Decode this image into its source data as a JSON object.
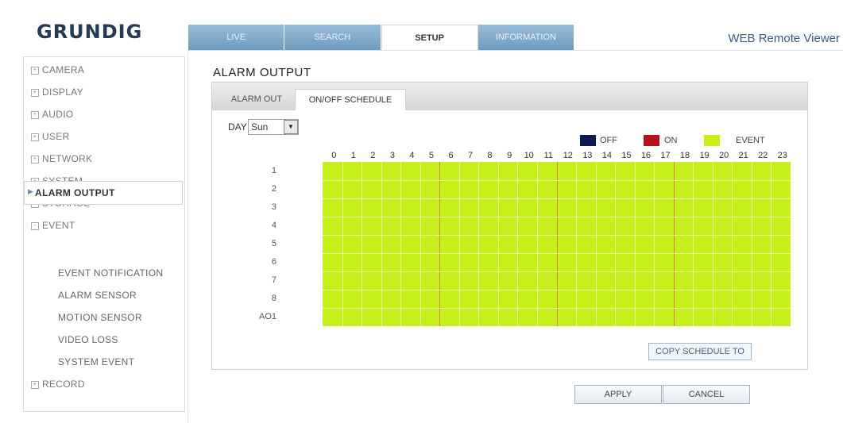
{
  "header": {
    "logo": "GRUNDIG",
    "title": "WEB Remote Viewer",
    "tabs": [
      {
        "label": "LIVE",
        "active": false
      },
      {
        "label": "SEARCH",
        "active": false
      },
      {
        "label": "SETUP",
        "active": true
      },
      {
        "label": "INFORMATION",
        "active": false
      }
    ]
  },
  "sidebar": {
    "items": [
      {
        "label": "CAMERA"
      },
      {
        "label": "DISPLAY"
      },
      {
        "label": "AUDIO"
      },
      {
        "label": "USER"
      },
      {
        "label": "NETWORK"
      },
      {
        "label": "SYSTEM"
      },
      {
        "label": "STORAGE"
      },
      {
        "label": "EVENT"
      },
      {
        "label": "RECORD"
      }
    ],
    "event_sub": [
      {
        "label": "ALARM OUTPUT",
        "active": true
      },
      {
        "label": "EVENT NOTIFICATION"
      },
      {
        "label": "ALARM SENSOR"
      },
      {
        "label": "MOTION SENSOR"
      },
      {
        "label": "VIDEO LOSS"
      },
      {
        "label": "SYSTEM EVENT"
      }
    ]
  },
  "content": {
    "title": "ALARM OUTPUT",
    "subtabs": [
      {
        "label": "ALARM OUT",
        "active": false
      },
      {
        "label": "ON/OFF SCHEDULE",
        "active": true
      }
    ],
    "day_label": "DAY",
    "day_value": "Sun",
    "legend": [
      {
        "label": "OFF",
        "color": "#0d1a4d"
      },
      {
        "label": "ON",
        "color": "#b5121b"
      },
      {
        "label": "EVENT",
        "color": "#c6f01a"
      }
    ],
    "hours": [
      "0",
      "1",
      "2",
      "3",
      "4",
      "5",
      "6",
      "7",
      "8",
      "9",
      "10",
      "11",
      "12",
      "13",
      "14",
      "15",
      "16",
      "17",
      "18",
      "19",
      "20",
      "21",
      "22",
      "23"
    ],
    "rows": [
      "1",
      "2",
      "3",
      "4",
      "5",
      "6",
      "7",
      "8",
      "AO1"
    ],
    "schedule_state": "EVENT",
    "copy_button": "COPY SCHEDULE TO",
    "apply_button": "APPLY",
    "cancel_button": "CANCEL"
  },
  "colors": {
    "event_fill": "#c6f01a",
    "tab_active_bg": "#ffffff",
    "tab_bg": "#7ea8c8",
    "accent": "#3b5b84"
  }
}
